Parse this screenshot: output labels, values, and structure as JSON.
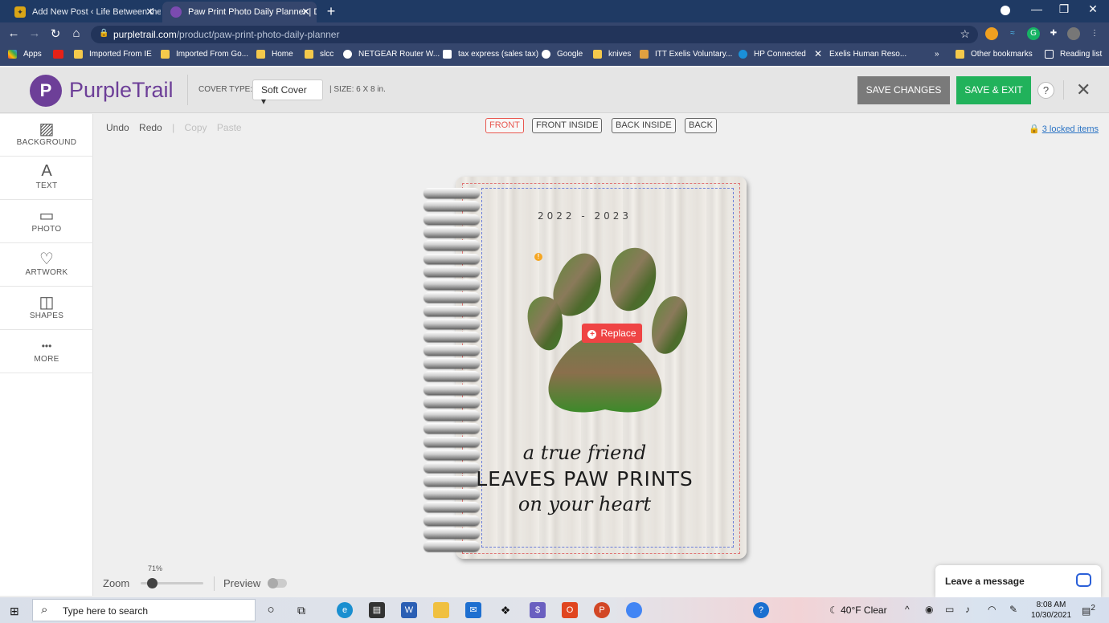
{
  "browser": {
    "tabs": [
      {
        "title": "Add New Post ‹ Life Between the",
        "close": "✕"
      },
      {
        "title": "Paw Print Photo Daily Planner | D",
        "close": "✕"
      }
    ],
    "new_tab": "+",
    "window_controls": {
      "minimize": "—",
      "restore": "❐",
      "close": "✕"
    },
    "url_domain": "purpletrail.com",
    "url_path": "/product/paw-print-photo-daily-planner",
    "bookmarks": [
      "Apps",
      "",
      "Imported From IE",
      "Imported From Go...",
      "Home",
      "slcc",
      "NETGEAR Router W...",
      "tax express (sales tax)",
      "Google",
      "knives",
      "ITT Exelis Voluntary...",
      "HP Connected",
      "Exelis Human Reso...",
      "»",
      "Other bookmarks",
      "Reading list"
    ]
  },
  "header": {
    "logo_letter": "P",
    "logo_text": "PurpleTrail",
    "cover_type_label": "COVER TYPE:",
    "cover_type_value": "Soft Cover ▾",
    "size_label": "|   SIZE: 6 X 8 in.",
    "save_changes": "SAVE CHANGES",
    "save_exit": "SAVE & EXIT",
    "help": "?",
    "close": "✕"
  },
  "sidebar": {
    "tools": [
      {
        "label": "BACKGROUND",
        "icon": "background-pattern-icon",
        "glyph": "▨"
      },
      {
        "label": "TEXT",
        "icon": "text-icon",
        "glyph": "A"
      },
      {
        "label": "PHOTO",
        "icon": "photo-icon",
        "glyph": "▭"
      },
      {
        "label": "ARTWORK",
        "icon": "heart-icon",
        "glyph": "♡"
      },
      {
        "label": "SHAPES",
        "icon": "shapes-icon",
        "glyph": "◫"
      },
      {
        "label": "MORE",
        "icon": "more-icon",
        "glyph": "•••"
      }
    ]
  },
  "toolbar": {
    "undo": "Undo",
    "redo": "Redo",
    "sep": "|",
    "copy": "Copy",
    "paste": "Paste"
  },
  "view_tabs": [
    "FRONT",
    "FRONT INSIDE",
    "BACK INSIDE",
    "BACK"
  ],
  "active_view": "FRONT",
  "locked_items": "3 locked items",
  "canvas": {
    "years": "2022 - 2023",
    "warning": "!",
    "replace_label": "Replace",
    "replace_plus": "+",
    "quote_line1": "a true friend",
    "quote_line2": "LEAVES PAW PRINTS",
    "quote_line3": "on your heart"
  },
  "zoom": {
    "label": "Zoom",
    "value": "71%",
    "level": 0.14,
    "preview_label": "Preview",
    "preview_on": false
  },
  "chat": {
    "label": "Leave a message"
  },
  "taskbar": {
    "start": "⊞",
    "search_placeholder": "Type here to search",
    "weather": "40°F  Clear",
    "time": "8:08 AM",
    "date": "10/30/2021",
    "notifications": "2"
  },
  "colors": {
    "brand_purple": "#6d3f98",
    "save_green": "#21b25b",
    "save_gray": "#7a7a7a",
    "replace_red": "#ef4444",
    "active_tab_red": "#e8574f",
    "link_blue": "#2a73c4",
    "chrome_dark": "#1f3a64",
    "chrome_mid": "#35466d"
  }
}
